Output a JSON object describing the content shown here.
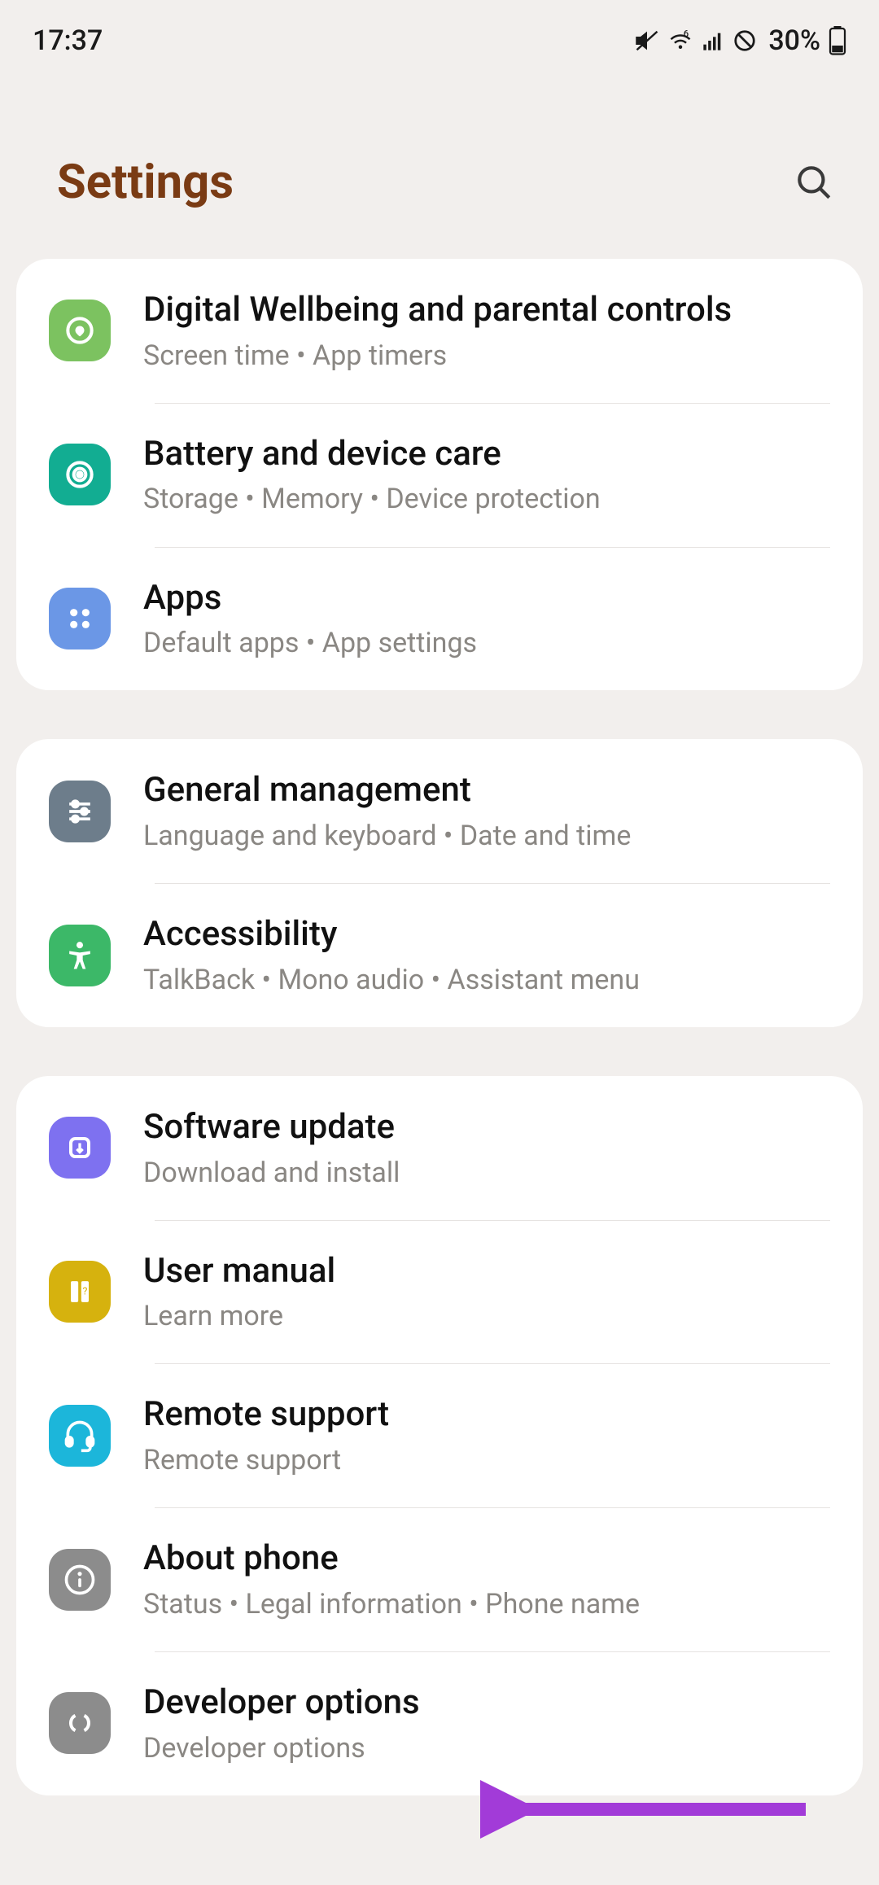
{
  "status": {
    "time": "17:37",
    "battery": "30%"
  },
  "header": {
    "title": "Settings"
  },
  "groups": [
    {
      "items": [
        {
          "icon": "wellbeing-icon",
          "bg": "bg-green1",
          "title": "Digital Wellbeing and parental controls",
          "sub": "Screen time  •  App timers"
        },
        {
          "icon": "battery-care-icon",
          "bg": "bg-teal",
          "title": "Battery and device care",
          "sub": "Storage  •  Memory  •  Device protection"
        },
        {
          "icon": "apps-icon",
          "bg": "bg-blue1",
          "title": "Apps",
          "sub": "Default apps  •  App settings"
        }
      ]
    },
    {
      "items": [
        {
          "icon": "sliders-icon",
          "bg": "bg-slate",
          "title": "General management",
          "sub": "Language and keyboard  •  Date and time"
        },
        {
          "icon": "accessibility-icon",
          "bg": "bg-green2",
          "title": "Accessibility",
          "sub": "TalkBack  •  Mono audio  •  Assistant menu"
        }
      ]
    },
    {
      "items": [
        {
          "icon": "update-icon",
          "bg": "bg-purple",
          "title": "Software update",
          "sub": "Download and install"
        },
        {
          "icon": "manual-icon",
          "bg": "bg-yellow",
          "title": "User manual",
          "sub": "Learn more"
        },
        {
          "icon": "headset-icon",
          "bg": "bg-cyan",
          "title": "Remote support",
          "sub": "Remote support"
        },
        {
          "icon": "info-icon",
          "bg": "bg-gray",
          "title": "About phone",
          "sub": "Status  •  Legal information  •  Phone name"
        },
        {
          "icon": "developer-icon",
          "bg": "bg-gray",
          "title": "Developer options",
          "sub": "Developer options"
        }
      ]
    }
  ]
}
